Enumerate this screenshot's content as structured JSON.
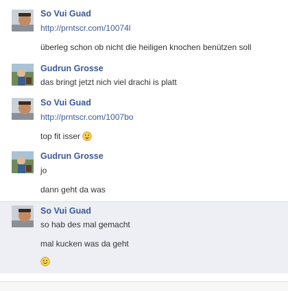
{
  "messages": [
    {
      "author": "So Vui Guad",
      "avatar": "avatar-man",
      "lines": [
        "http://prntscr.com/10074l",
        "überleg schon ob nicht die heiligen knochen benützen soll"
      ]
    },
    {
      "author": "Gudrun Grosse",
      "avatar": "avatar-woman",
      "lines": [
        "das bringt jetzt nich viel drachi is platt"
      ]
    },
    {
      "author": "So Vui Guad",
      "avatar": "avatar-man",
      "lines": [
        "http://prntscr.com/1007bo",
        "top fit isser"
      ]
    },
    {
      "author": "Gudrun Grosse",
      "avatar": "avatar-woman",
      "lines": [
        "jo",
        "dann geht da was"
      ]
    },
    {
      "author": "So Vui Guad",
      "avatar": "avatar-man",
      "lines": [
        "so hab des mal gemacht",
        "mal kucken was da geht"
      ]
    }
  ],
  "emojis": [
    "tongue-emoji",
    "smile-emoji"
  ],
  "colors": {
    "author": "#3b5998",
    "highlight": "#edeff4",
    "text": "#333333"
  }
}
